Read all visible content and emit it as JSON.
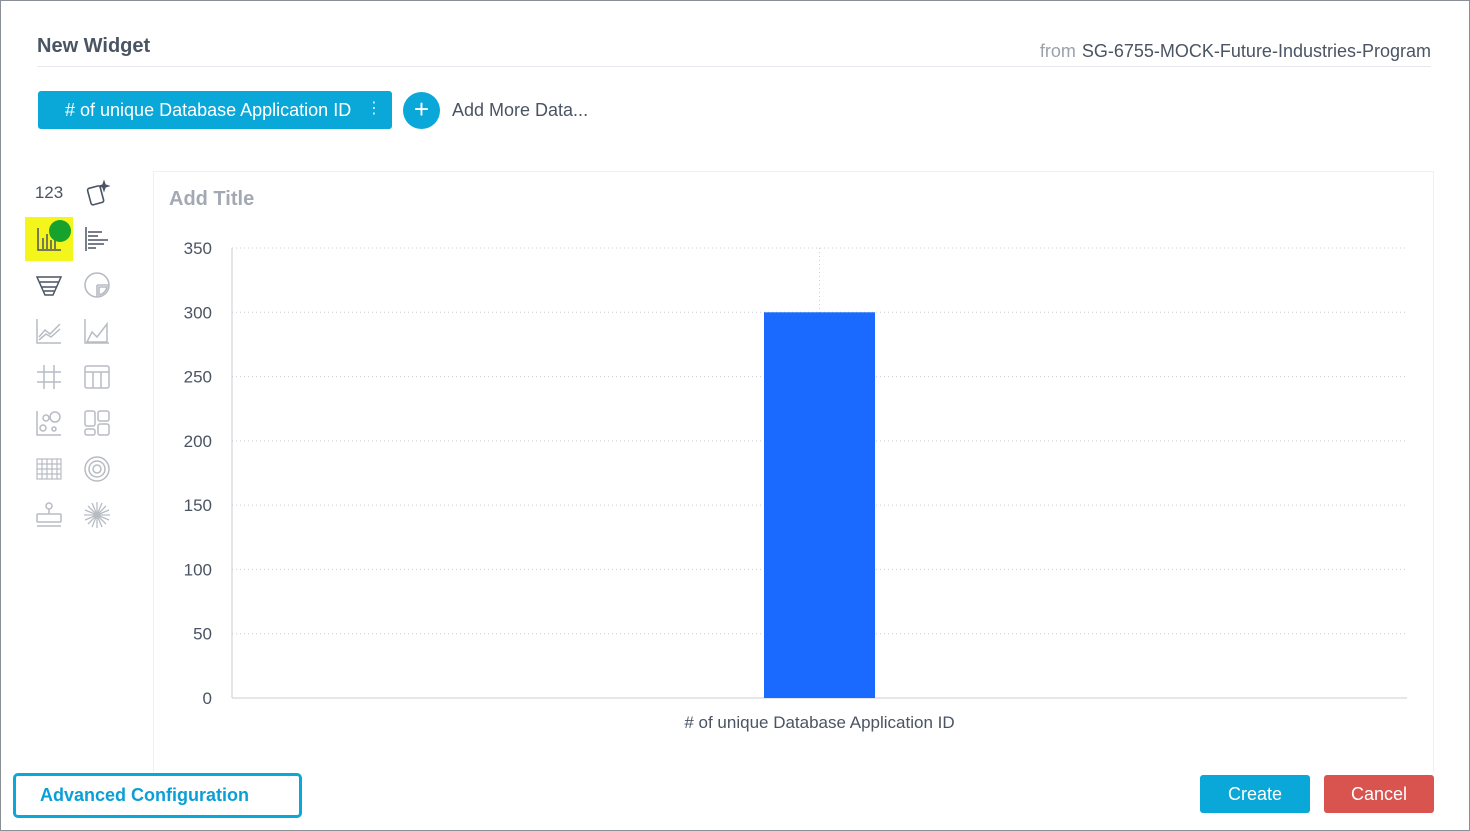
{
  "widget": {
    "title": "New Widget",
    "source_prefix": "from",
    "source_name": "SG-6755-MOCK-Future-Industries-Program"
  },
  "data_pills": [
    {
      "label": "# of unique Database Application ID",
      "menu_glyph": "⋮"
    }
  ],
  "add_more": {
    "icon": "+",
    "label": "Add More Data..."
  },
  "viz_types": [
    {
      "name": "number-viz",
      "text": "123",
      "icon": "number-icon"
    },
    {
      "name": "custom-viz",
      "icon": "magic-card-icon"
    },
    {
      "name": "column-chart",
      "icon": "column-chart-icon",
      "selected": true
    },
    {
      "name": "bar-chart",
      "icon": "bar-chart-icon"
    },
    {
      "name": "funnel-chart",
      "icon": "funnel-icon"
    },
    {
      "name": "pie-chart",
      "icon": "pie-chart-icon"
    },
    {
      "name": "line-chart",
      "icon": "line-chart-icon"
    },
    {
      "name": "area-chart",
      "icon": "area-chart-icon"
    },
    {
      "name": "pivot-table",
      "icon": "pivot-grid-icon"
    },
    {
      "name": "table",
      "icon": "table-icon"
    },
    {
      "name": "scatter-chart",
      "icon": "scatter-icon"
    },
    {
      "name": "blox",
      "icon": "blox-icon"
    },
    {
      "name": "calendar-heatmap",
      "icon": "calendar-heatmap-icon"
    },
    {
      "name": "polar-chart",
      "icon": "polar-icon"
    },
    {
      "name": "indicator",
      "icon": "indicator-icon"
    },
    {
      "name": "sunburst",
      "icon": "sunburst-icon"
    }
  ],
  "chart_placeholder_title": "Add Title",
  "chart_data": {
    "type": "bar",
    "categories": [
      "# of unique Database Application ID"
    ],
    "series": [
      {
        "values": [
          300
        ]
      }
    ],
    "ylim": [
      0,
      350
    ],
    "yticks": [
      0,
      50,
      100,
      150,
      200,
      250,
      300,
      350
    ],
    "grid": true,
    "color": "#1a6aff"
  },
  "footer": {
    "advanced_label": "Advanced Configuration",
    "create_label": "Create",
    "cancel_label": "Cancel"
  },
  "colors": {
    "accent": "#0aa7d9",
    "danger": "#d9534f",
    "highlight": "#f4f51a",
    "status_dot": "#17a22d"
  }
}
